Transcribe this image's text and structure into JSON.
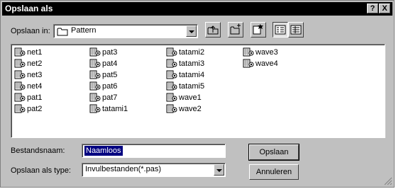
{
  "title": "Opslaan als",
  "title_buttons": {
    "help": "?",
    "close": "X"
  },
  "lookin": {
    "label": "Opslaan in:",
    "folder": "Pattern",
    "folder_icon": "folder-icon"
  },
  "toolbar": [
    "up-one-level-icon",
    "new-folder-icon",
    "add-favorite-icon",
    "list-view-icon",
    "details-view-icon"
  ],
  "files": [
    [
      "net1",
      "net2",
      "net3",
      "net4",
      "pat1",
      "pat2"
    ],
    [
      "pat3",
      "pat4",
      "pat5",
      "pat6",
      "pat7",
      "tatami1"
    ],
    [
      "tatami2",
      "tatami3",
      "tatami4",
      "tatami5",
      "wave1",
      "wave2"
    ],
    [
      "wave3",
      "wave4"
    ]
  ],
  "filename": {
    "label": "Bestandsnaam:",
    "value": "Naamloos"
  },
  "filetype": {
    "label": "Opslaan als type:",
    "value": "Invulbestanden(*.pas)"
  },
  "buttons": {
    "save": "Opslaan",
    "cancel": "Annuleren"
  },
  "colors": {
    "titlebar": "#000000",
    "dialog": "#c0c0c0",
    "selection": "#000080"
  }
}
